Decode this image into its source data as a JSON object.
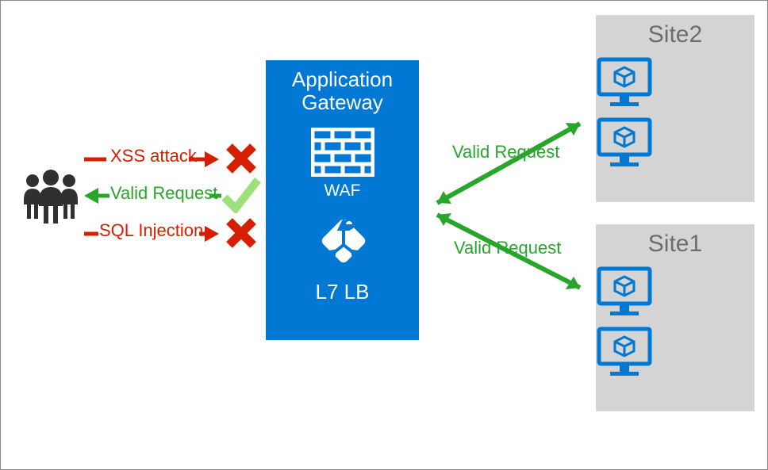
{
  "requests": {
    "xss": "XSS attack",
    "valid": "Valid Request",
    "sqli": "SQL Injection"
  },
  "gateway": {
    "title_line1": "Application",
    "title_line2": "Gateway",
    "waf_label": "WAF",
    "lb_label": "L7 LB"
  },
  "routes": {
    "to_site2": "Valid Request",
    "to_site1": "Valid Request"
  },
  "sites": {
    "site2": "Site2",
    "site1": "Site1"
  },
  "colors": {
    "azure_blue": "#0078d4",
    "red": "#d61e00",
    "green": "#27a62a",
    "gray_box": "#d4d4d4",
    "text_gray": "#6d6d6d",
    "dark": "#303030"
  }
}
